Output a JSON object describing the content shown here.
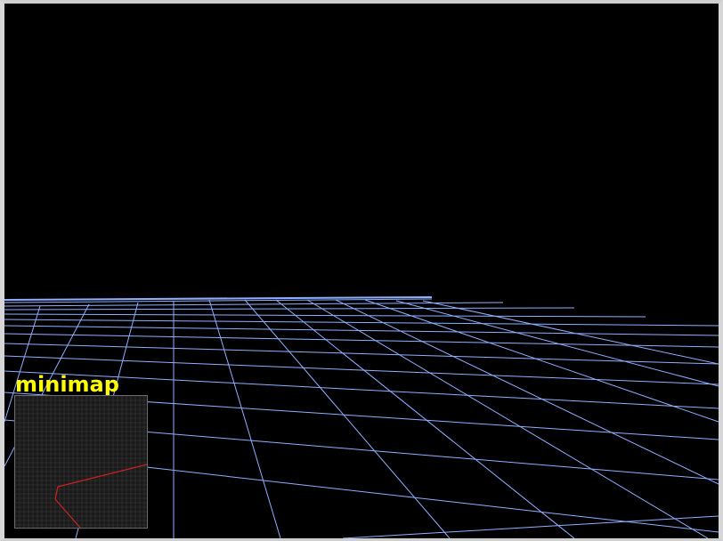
{
  "scene": {
    "background_color": "#000000",
    "grid_color": "#8fb0ff",
    "grid_highlight_color": "#b8cfff"
  },
  "minimap": {
    "label": "minimap",
    "label_color": "#ffff00",
    "background_color": "#1a1a1a",
    "grid_color": "#3a3a3a",
    "path_color": "#cc2222"
  }
}
